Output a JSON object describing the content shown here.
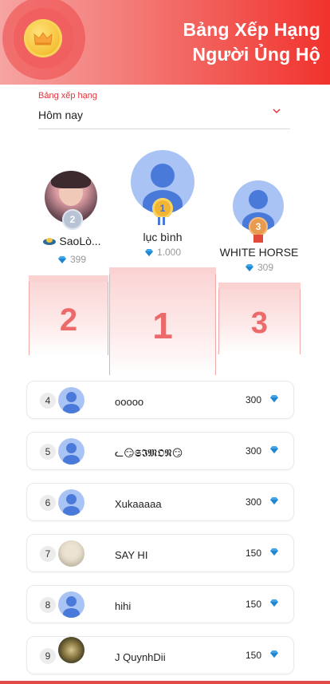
{
  "header": {
    "title_line1": "Bảng Xếp Hạng",
    "title_line2": "Người Ủng Hộ",
    "icon": "crown-icon",
    "colors": {
      "gradient_start": "#f6a4a2",
      "gradient_end": "#f1322d",
      "coin": "#f6c33b"
    }
  },
  "selector": {
    "label": "Bảng xếp hạng",
    "value": "Hôm nay",
    "icon": "chevron-down-icon"
  },
  "podium": [
    {
      "rank": "1",
      "name": "lục bình",
      "score": "1.000",
      "avatar": "default-avatar",
      "medal_color": "#f2b632"
    },
    {
      "rank": "2",
      "name": "SaoLò...",
      "score": "399",
      "avatar": "photo-avatar",
      "medal_color": "#b9c3d6"
    },
    {
      "rank": "3",
      "name": "WHITE HORSE",
      "score": "309",
      "avatar": "default-avatar",
      "medal_color": "#e89a4e"
    }
  ],
  "blocks": {
    "first": "1",
    "second": "2",
    "third": "3"
  },
  "rows": [
    {
      "rank": "4",
      "name": "ooooo",
      "score": "300",
      "avatar": "default-avatar"
    },
    {
      "rank": "5",
      "name": "ᓚ😏𝕾𝕴𝕸𝕺𝕹😏",
      "score": "300",
      "avatar": "default-avatar"
    },
    {
      "rank": "6",
      "name": "Xukaaaaa",
      "score": "300",
      "avatar": "default-avatar"
    },
    {
      "rank": "7",
      "name": "SAY HI",
      "score": "150",
      "avatar": "photo-avatar"
    },
    {
      "rank": "8",
      "name": "hihi",
      "score": "150",
      "avatar": "default-avatar"
    },
    {
      "rank": "9",
      "name": "J QuynhDii",
      "score": "150",
      "avatar": "photo-avatar"
    }
  ],
  "currency_icon": "diamond-icon",
  "accent_color": "#e0353d"
}
